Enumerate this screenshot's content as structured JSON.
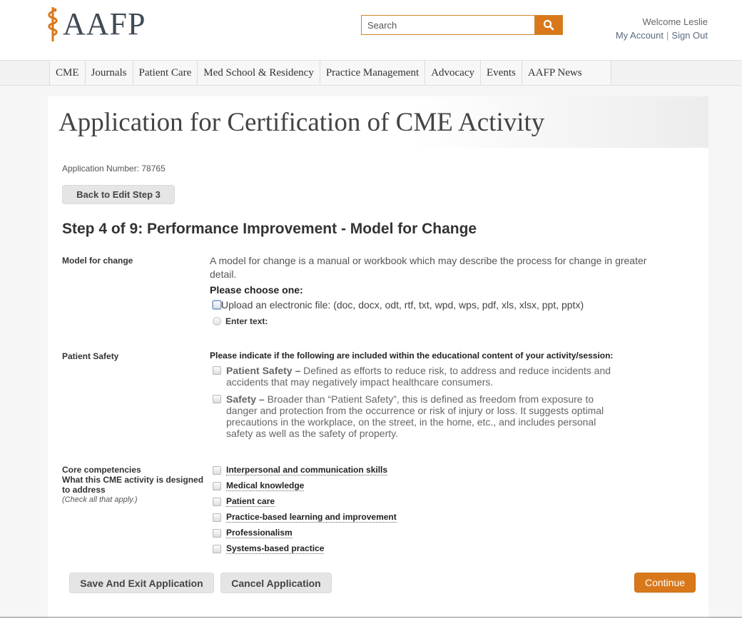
{
  "header": {
    "logo_text": "AAFP",
    "search": {
      "placeholder": "Search"
    },
    "welcome": "Welcome Leslie",
    "my_account": "My Account",
    "sign_out": "Sign Out"
  },
  "nav": {
    "items": [
      {
        "label": "CME"
      },
      {
        "label": "Journals"
      },
      {
        "label": "Patient Care"
      },
      {
        "label": "Med School & Residency"
      },
      {
        "label": "Practice Management"
      },
      {
        "label": "Advocacy"
      },
      {
        "label": "Events"
      },
      {
        "label": "AAFP News"
      }
    ]
  },
  "page": {
    "title": "Application for Certification of CME Activity",
    "application_number": "Application Number: 78765",
    "back_button": "Back to Edit Step 3",
    "step_title": "Step 4 of 9: Performance Improvement - Model for Change"
  },
  "model_for_change": {
    "label": "Model for change",
    "description": "A model for change is a manual or workbook which may describe the process for change in greater detail.",
    "choose": "Please choose one:",
    "upload_option": "Upload an electronic file: (doc, docx, odt, rtf, txt, wpd, wps, pdf, xls, xlsx, ppt, pptx)",
    "text_option": "Enter text:"
  },
  "patient_safety": {
    "label": "Patient Safety",
    "intro": "Please indicate if the following are included within the educational content of your activity/session:",
    "items": [
      {
        "term": "Patient Safety –",
        "text": " Defined as efforts to reduce risk, to address and reduce incidents and accidents that may negatively impact healthcare consumers."
      },
      {
        "term": "Safety –",
        "text": " Broader than “Patient Safety”, this is defined as freedom from exposure to danger and protection from the occurrence or risk of injury or loss. It suggests optimal precautions in the workplace, on the street, in the home, etc., and includes personal safety as well as the safety of property."
      }
    ]
  },
  "core_competencies": {
    "label": "Core competencies",
    "label2": "What this CME activity is designed to address",
    "hint": "(Check all that apply.)",
    "items": [
      {
        "label": "Interpersonal and communication skills"
      },
      {
        "label": "Medical knowledge"
      },
      {
        "label": "Patient care"
      },
      {
        "label": "Practice-based learning and improvement"
      },
      {
        "label": "Professionalism"
      },
      {
        "label": "Systems-based practice"
      }
    ]
  },
  "footer_buttons": {
    "save_exit": "Save And Exit Application",
    "cancel": "Cancel Application",
    "continue": "Continue"
  },
  "colors": {
    "accent": "#d9781a",
    "logo": "#3f4a55"
  }
}
